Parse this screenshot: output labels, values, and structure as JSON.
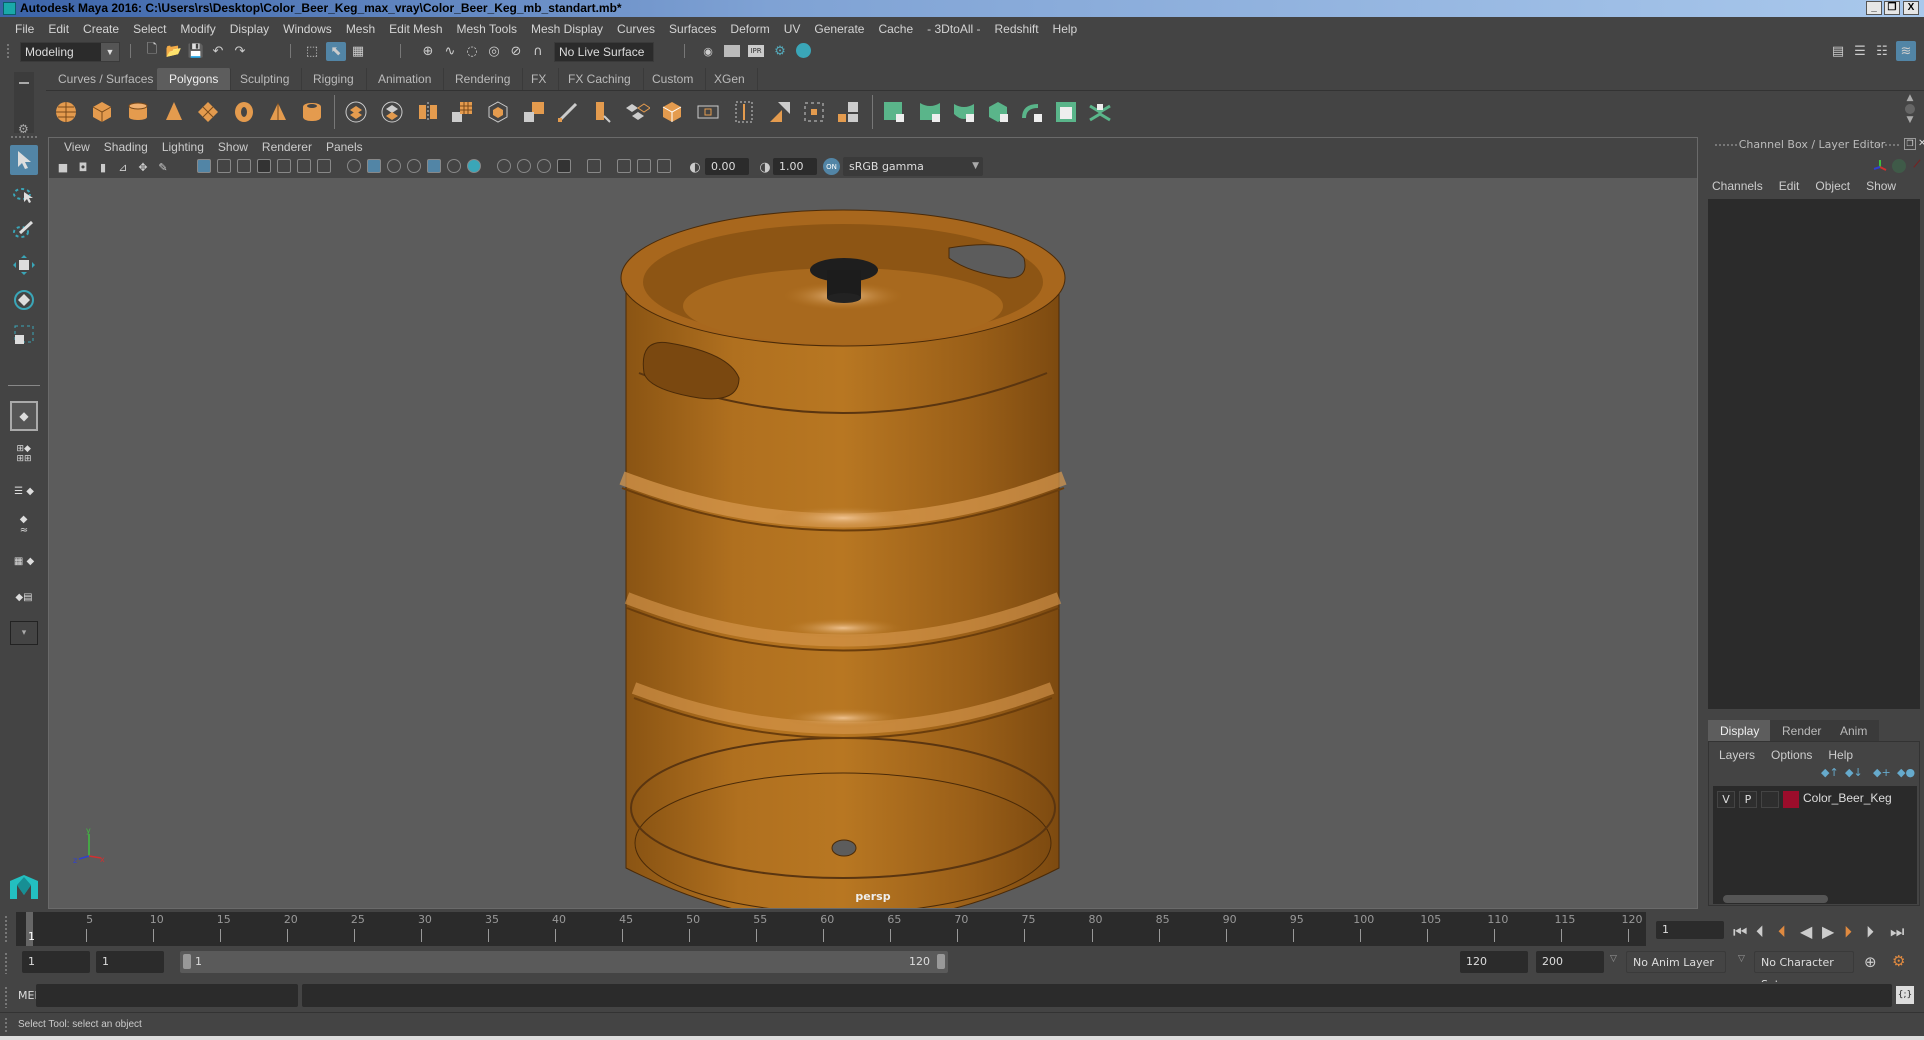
{
  "title_bar": {
    "title": "Autodesk Maya 2016: C:\\Users\\rs\\Desktop\\Color_Beer_Keg_max_vray\\Color_Beer_Keg_mb_standart.mb*",
    "minimize": "_",
    "restore": "❐",
    "close": "X"
  },
  "menu_bar": [
    "File",
    "Edit",
    "Create",
    "Select",
    "Modify",
    "Display",
    "Windows",
    "Mesh",
    "Edit Mesh",
    "Mesh Tools",
    "Mesh Display",
    "Curves",
    "Surfaces",
    "Deform",
    "UV",
    "Generate",
    "Cache",
    "- 3DtoAll -",
    "Redshift",
    "Help"
  ],
  "status_line": {
    "menu_set": "Modeling",
    "live_surface": "No Live Surface",
    "icons": [
      "new-scene",
      "open-scene",
      "save-scene",
      "undo",
      "redo",
      "select-hierarchy",
      "select-object",
      "select-component",
      "snap-grid",
      "snap-curve",
      "snap-point",
      "snap-view-plane",
      "snap-live",
      "snap-surface",
      "render-view",
      "render-current",
      "ipr-render",
      "render-settings",
      "hypershade"
    ]
  },
  "shelf": {
    "tabs": [
      "Curves / Surfaces",
      "Polygons",
      "Sculpting",
      "Rigging",
      "Animation",
      "Rendering",
      "FX",
      "FX Caching",
      "Custom",
      "XGen"
    ],
    "active_tab": "Polygons",
    "accent_orange": "#e49b4e",
    "accent_green": "#5ab58a"
  },
  "viewport": {
    "menus": [
      "View",
      "Shading",
      "Lighting",
      "Show",
      "Renderer",
      "Panels"
    ],
    "exposure": "0.00",
    "gamma": "1.00",
    "color_space": "sRGB gamma",
    "camera_label": "persp",
    "object_color": "#a7661c",
    "background": "#5c5c5c"
  },
  "channel_box": {
    "title": "Channel Box / Layer Editor",
    "menus": [
      "Channels",
      "Edit",
      "Object",
      "Show"
    ]
  },
  "layer_editor": {
    "tabs": [
      "Display",
      "Render",
      "Anim"
    ],
    "active_tab": "Display",
    "menus": [
      "Layers",
      "Options",
      "Help"
    ],
    "layers": [
      {
        "visible": "V",
        "playback": "P",
        "color": "#9b0d2b",
        "name": "Color_Beer_Keg"
      }
    ]
  },
  "timeline": {
    "ticks": [
      5,
      10,
      15,
      20,
      25,
      30,
      35,
      40,
      45,
      50,
      55,
      60,
      65,
      70,
      75,
      80,
      85,
      90,
      95,
      100,
      105,
      110,
      115,
      120
    ],
    "current_frame_marker": "1",
    "current_frame": "1",
    "range_start": 1,
    "range_end": 120
  },
  "range_slider": {
    "start_time": "1",
    "playback_start": "1",
    "slider_start_label": "1",
    "slider_end_label": "120",
    "playback_end": "120",
    "end_time": "200",
    "anim_layer": "No Anim Layer",
    "character_set": "No Character Set"
  },
  "command_line": {
    "label": "MEL",
    "input": "",
    "output": ""
  },
  "help_line": "Select Tool: select an object"
}
